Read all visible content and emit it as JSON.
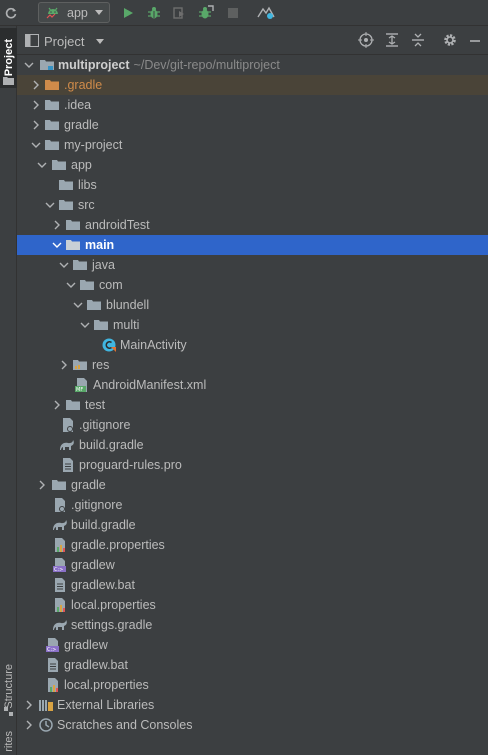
{
  "toolbar": {
    "run_config_label": "app",
    "icons": [
      "sync-icon",
      "android-icon",
      "run-icon",
      "debug-icon",
      "profile-icon",
      "attach-debugger-icon",
      "stop-icon",
      "apply-changes-icon"
    ]
  },
  "left_strip": {
    "project_tab": "Project",
    "structure_tab": "Structure",
    "favorites_tab": "rites"
  },
  "panel": {
    "title": "Project"
  },
  "tree": {
    "root_name": "multiproject",
    "root_path": "~/Dev/git-repo/multiproject",
    "rows": [
      {
        "label": ".gradle"
      },
      {
        "label": ".idea"
      },
      {
        "label": "gradle"
      },
      {
        "label": "my-project"
      },
      {
        "label": "app"
      },
      {
        "label": "libs"
      },
      {
        "label": "src"
      },
      {
        "label": "androidTest"
      },
      {
        "label": "main"
      },
      {
        "label": "java"
      },
      {
        "label": "com"
      },
      {
        "label": "blundell"
      },
      {
        "label": "multi"
      },
      {
        "label": "MainActivity"
      },
      {
        "label": "res"
      },
      {
        "label": "AndroidManifest.xml"
      },
      {
        "label": "test"
      },
      {
        "label": ".gitignore"
      },
      {
        "label": "build.gradle"
      },
      {
        "label": "proguard-rules.pro"
      },
      {
        "label": "gradle"
      },
      {
        "label": ".gitignore"
      },
      {
        "label": "build.gradle"
      },
      {
        "label": "gradle.properties"
      },
      {
        "label": "gradlew"
      },
      {
        "label": "gradlew.bat"
      },
      {
        "label": "local.properties"
      },
      {
        "label": "settings.gradle"
      },
      {
        "label": "gradlew"
      },
      {
        "label": "gradlew.bat"
      },
      {
        "label": "local.properties"
      },
      {
        "label": "External Libraries"
      },
      {
        "label": "Scratches and Consoles"
      }
    ]
  },
  "colors": {
    "background": "#3c3f41",
    "selection": "#2f65ca",
    "folder": "#9aa7b0",
    "excluded_folder": "#d08b4a",
    "run_green": "#59a869",
    "kotlin_blue": "#40b6e0"
  }
}
